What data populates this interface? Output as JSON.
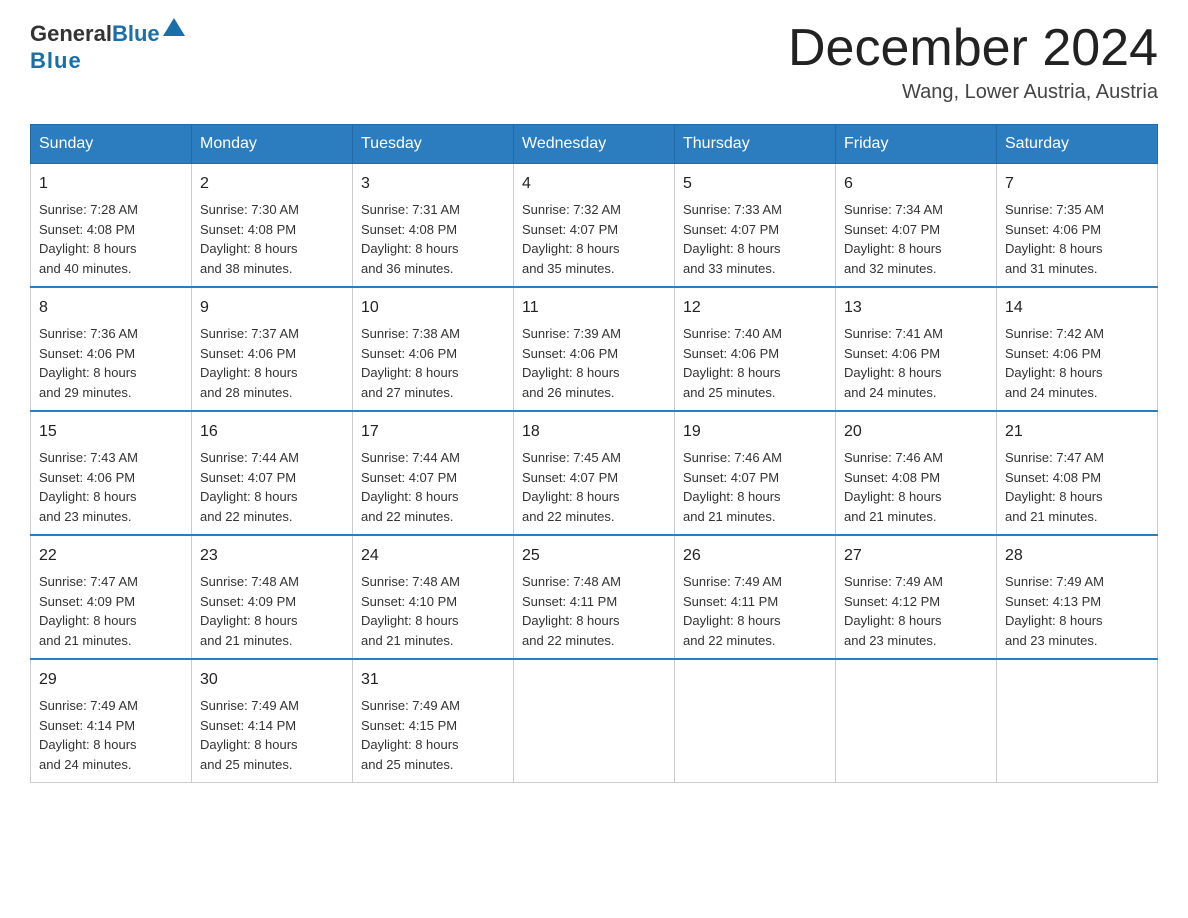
{
  "header": {
    "logo_general": "General",
    "logo_blue": "Blue",
    "month_title": "December 2024",
    "location": "Wang, Lower Austria, Austria"
  },
  "days_of_week": [
    "Sunday",
    "Monday",
    "Tuesday",
    "Wednesday",
    "Thursday",
    "Friday",
    "Saturday"
  ],
  "weeks": [
    [
      {
        "day": "1",
        "sunrise": "7:28 AM",
        "sunset": "4:08 PM",
        "daylight": "8 hours and 40 minutes."
      },
      {
        "day": "2",
        "sunrise": "7:30 AM",
        "sunset": "4:08 PM",
        "daylight": "8 hours and 38 minutes."
      },
      {
        "day": "3",
        "sunrise": "7:31 AM",
        "sunset": "4:08 PM",
        "daylight": "8 hours and 36 minutes."
      },
      {
        "day": "4",
        "sunrise": "7:32 AM",
        "sunset": "4:07 PM",
        "daylight": "8 hours and 35 minutes."
      },
      {
        "day": "5",
        "sunrise": "7:33 AM",
        "sunset": "4:07 PM",
        "daylight": "8 hours and 33 minutes."
      },
      {
        "day": "6",
        "sunrise": "7:34 AM",
        "sunset": "4:07 PM",
        "daylight": "8 hours and 32 minutes."
      },
      {
        "day": "7",
        "sunrise": "7:35 AM",
        "sunset": "4:06 PM",
        "daylight": "8 hours and 31 minutes."
      }
    ],
    [
      {
        "day": "8",
        "sunrise": "7:36 AM",
        "sunset": "4:06 PM",
        "daylight": "8 hours and 29 minutes."
      },
      {
        "day": "9",
        "sunrise": "7:37 AM",
        "sunset": "4:06 PM",
        "daylight": "8 hours and 28 minutes."
      },
      {
        "day": "10",
        "sunrise": "7:38 AM",
        "sunset": "4:06 PM",
        "daylight": "8 hours and 27 minutes."
      },
      {
        "day": "11",
        "sunrise": "7:39 AM",
        "sunset": "4:06 PM",
        "daylight": "8 hours and 26 minutes."
      },
      {
        "day": "12",
        "sunrise": "7:40 AM",
        "sunset": "4:06 PM",
        "daylight": "8 hours and 25 minutes."
      },
      {
        "day": "13",
        "sunrise": "7:41 AM",
        "sunset": "4:06 PM",
        "daylight": "8 hours and 24 minutes."
      },
      {
        "day": "14",
        "sunrise": "7:42 AM",
        "sunset": "4:06 PM",
        "daylight": "8 hours and 24 minutes."
      }
    ],
    [
      {
        "day": "15",
        "sunrise": "7:43 AM",
        "sunset": "4:06 PM",
        "daylight": "8 hours and 23 minutes."
      },
      {
        "day": "16",
        "sunrise": "7:44 AM",
        "sunset": "4:07 PM",
        "daylight": "8 hours and 22 minutes."
      },
      {
        "day": "17",
        "sunrise": "7:44 AM",
        "sunset": "4:07 PM",
        "daylight": "8 hours and 22 minutes."
      },
      {
        "day": "18",
        "sunrise": "7:45 AM",
        "sunset": "4:07 PM",
        "daylight": "8 hours and 22 minutes."
      },
      {
        "day": "19",
        "sunrise": "7:46 AM",
        "sunset": "4:07 PM",
        "daylight": "8 hours and 21 minutes."
      },
      {
        "day": "20",
        "sunrise": "7:46 AM",
        "sunset": "4:08 PM",
        "daylight": "8 hours and 21 minutes."
      },
      {
        "day": "21",
        "sunrise": "7:47 AM",
        "sunset": "4:08 PM",
        "daylight": "8 hours and 21 minutes."
      }
    ],
    [
      {
        "day": "22",
        "sunrise": "7:47 AM",
        "sunset": "4:09 PM",
        "daylight": "8 hours and 21 minutes."
      },
      {
        "day": "23",
        "sunrise": "7:48 AM",
        "sunset": "4:09 PM",
        "daylight": "8 hours and 21 minutes."
      },
      {
        "day": "24",
        "sunrise": "7:48 AM",
        "sunset": "4:10 PM",
        "daylight": "8 hours and 21 minutes."
      },
      {
        "day": "25",
        "sunrise": "7:48 AM",
        "sunset": "4:11 PM",
        "daylight": "8 hours and 22 minutes."
      },
      {
        "day": "26",
        "sunrise": "7:49 AM",
        "sunset": "4:11 PM",
        "daylight": "8 hours and 22 minutes."
      },
      {
        "day": "27",
        "sunrise": "7:49 AM",
        "sunset": "4:12 PM",
        "daylight": "8 hours and 23 minutes."
      },
      {
        "day": "28",
        "sunrise": "7:49 AM",
        "sunset": "4:13 PM",
        "daylight": "8 hours and 23 minutes."
      }
    ],
    [
      {
        "day": "29",
        "sunrise": "7:49 AM",
        "sunset": "4:14 PM",
        "daylight": "8 hours and 24 minutes."
      },
      {
        "day": "30",
        "sunrise": "7:49 AM",
        "sunset": "4:14 PM",
        "daylight": "8 hours and 25 minutes."
      },
      {
        "day": "31",
        "sunrise": "7:49 AM",
        "sunset": "4:15 PM",
        "daylight": "8 hours and 25 minutes."
      },
      null,
      null,
      null,
      null
    ]
  ],
  "labels": {
    "sunrise": "Sunrise:",
    "sunset": "Sunset:",
    "daylight": "Daylight:"
  },
  "accent_color": "#2b7dc0"
}
